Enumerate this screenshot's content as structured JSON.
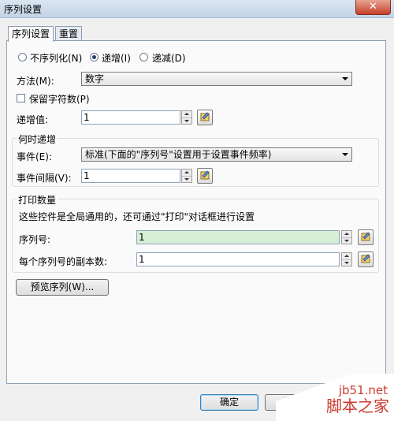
{
  "window": {
    "title": "序列设置",
    "close_glyph": "✕"
  },
  "tabs": [
    {
      "label": "序列设置"
    },
    {
      "label": "重置"
    }
  ],
  "mode": {
    "options": [
      {
        "label": "不序列化(N)"
      },
      {
        "label": "递增(I)"
      },
      {
        "label": "递减(D)"
      }
    ],
    "selected": "递增(I)"
  },
  "method": {
    "label": "方法(M):",
    "value": "数字"
  },
  "keep_chars": {
    "label": "保留字符数(P)",
    "checked": false
  },
  "increment": {
    "label": "递增值:",
    "value": "1"
  },
  "when_group": {
    "title": "何时递增",
    "event_label": "事件(E):",
    "event_value": "标准(下面的\"序列号\"设置用于设置事件频率)",
    "interval_label": "事件间隔(V):",
    "interval_value": "1"
  },
  "print_group": {
    "title": "打印数量",
    "description": "这些控件是全局通用的，还可通过\"打印\"对话框进行设置",
    "serial_label": "序列号:",
    "serial_value": "1",
    "copies_label": "每个序列号的副本数:",
    "copies_value": "1"
  },
  "preview_button": "预览序列(W)...",
  "footer": {
    "ok": "确定",
    "cancel_partial": "取"
  },
  "watermark": {
    "line1": "jb51.net",
    "line2": "脚本之家"
  },
  "colors": {
    "serial_field_bg": "#d6efd4",
    "title_bar": "#c3d3e6",
    "close_button": "#c4402a"
  }
}
